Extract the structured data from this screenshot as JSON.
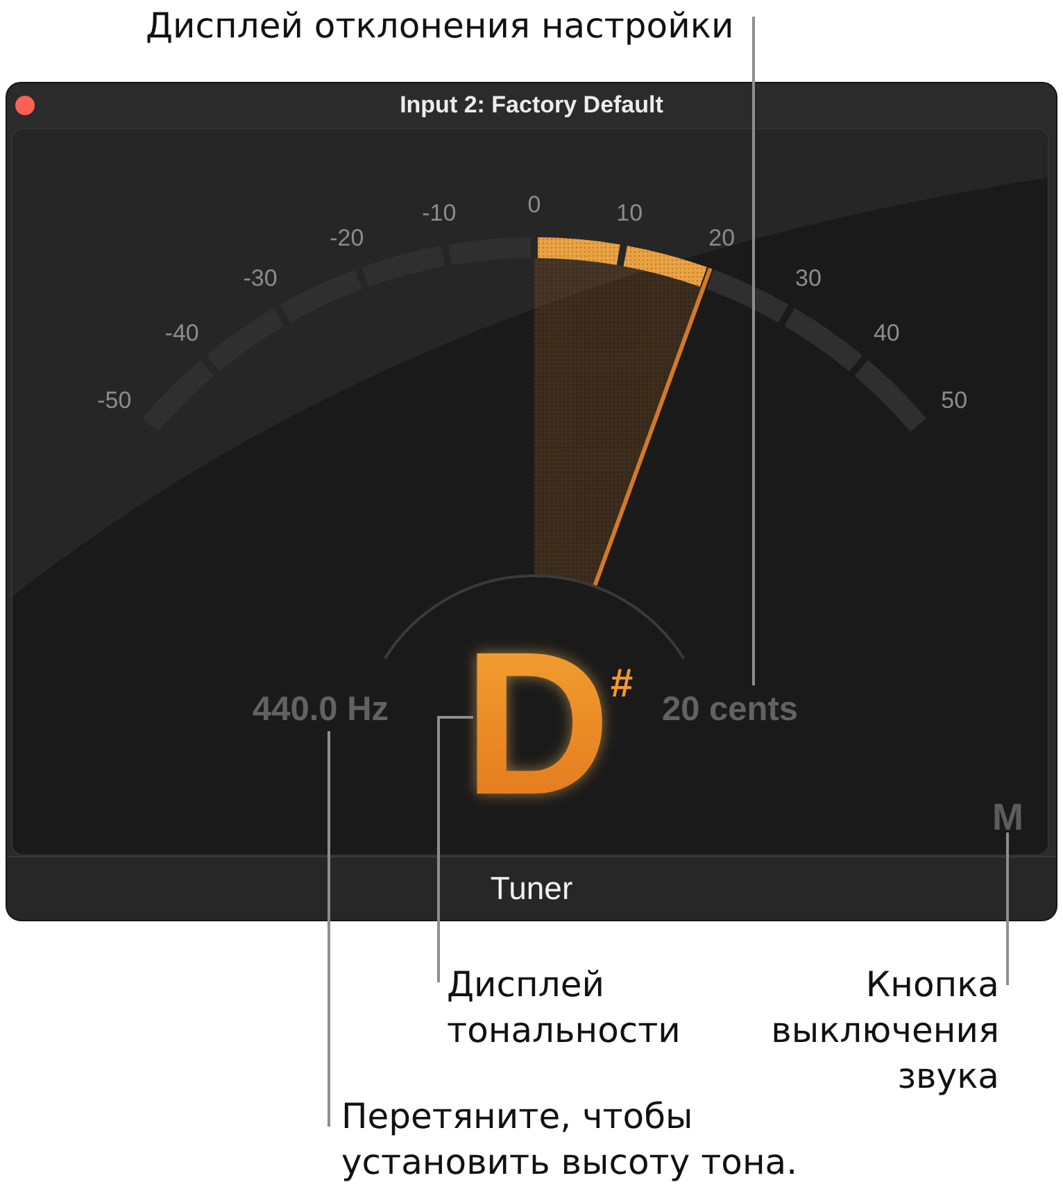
{
  "window": {
    "title": "Input 2: Factory Default",
    "footer_title": "Tuner"
  },
  "tuner": {
    "scale_labels": [
      "-50",
      "-40",
      "-30",
      "-20",
      "-10",
      "0",
      "10",
      "20",
      "30",
      "40",
      "50"
    ],
    "meter": {
      "level": 0.7
    },
    "frequency": "440.0 Hz",
    "note": "D",
    "accidental": "#",
    "deviation": "20 cents",
    "mute_button": {
      "label": "M"
    }
  },
  "callouts": [
    "Дисплей отклонения настройки",
    "Дисплей тональности",
    "Кнопка выключения звука",
    "Перетяните, чтобы установить высоту тона."
  ]
}
